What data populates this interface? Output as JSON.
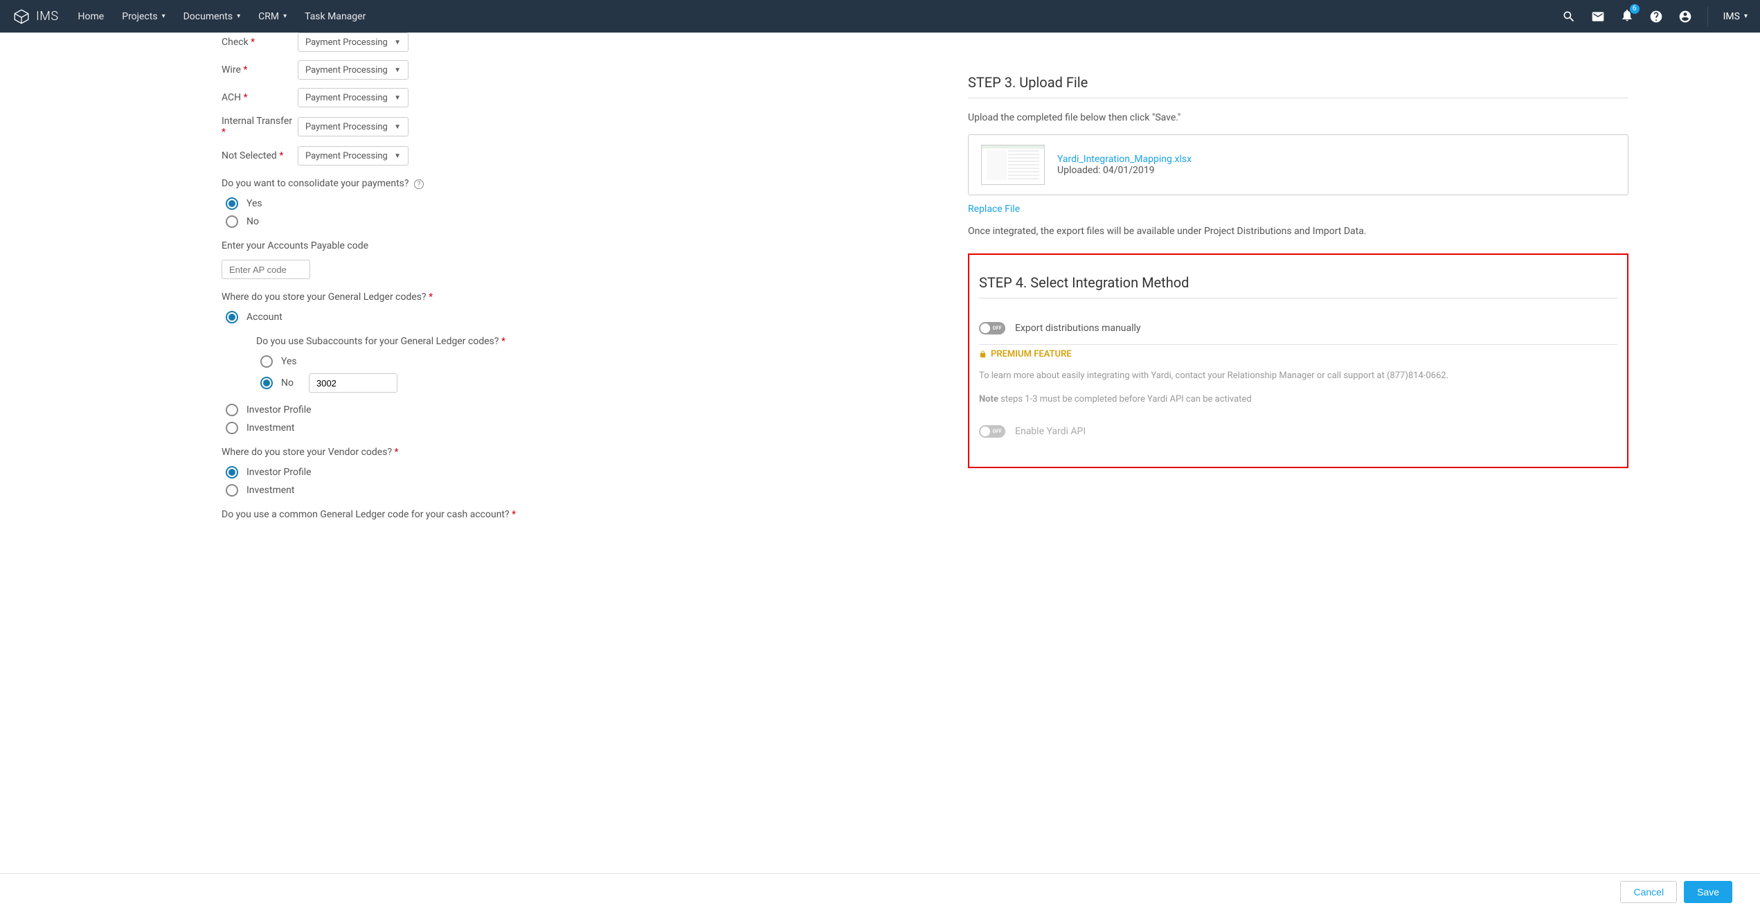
{
  "header": {
    "logo": "IMS",
    "nav": [
      "Home",
      "Projects",
      "Documents",
      "CRM",
      "Task Manager"
    ],
    "badge": "6",
    "org": "IMS"
  },
  "left": {
    "payment_rows": [
      {
        "label": "Check",
        "value": "Payment Processing"
      },
      {
        "label": "Wire",
        "value": "Payment Processing"
      },
      {
        "label": "ACH",
        "value": "Payment Processing"
      },
      {
        "label": "Internal Transfer",
        "value": "Payment Processing"
      },
      {
        "label": "Not Selected",
        "value": "Payment Processing"
      }
    ],
    "consolidate_q": "Do you want to consolidate your payments?",
    "yes": "Yes",
    "no": "No",
    "ap_label": "Enter your Accounts Payable code",
    "ap_placeholder": "Enter AP code",
    "gl_q": "Where do you store your General Ledger codes?",
    "opt_account": "Account",
    "sub_q": "Do you use Subaccounts for your General Ledger codes?",
    "sub_no_value": "3002",
    "opt_investor_profile": "Investor Profile",
    "opt_investment": "Investment",
    "vendor_q": "Where do you store your Vendor codes?",
    "common_gl_q": "Do you use a common General Ledger code for your cash account?"
  },
  "right": {
    "step3_title": "STEP 3. Upload File",
    "step3_desc": "Upload the completed file below then click \"Save.\"",
    "file_name": "Yardi_Integration_Mapping.xlsx",
    "file_uploaded": "Uploaded: 04/01/2019",
    "replace": "Replace File",
    "step3_after": "Once integrated, the export files will be available under Project Distributions and Import Data.",
    "step4_title": "STEP 4. Select Integration Method",
    "toggle_off": "OFF",
    "toggle1_label": "Export distributions manually",
    "premium_label": "PREMIUM FEATURE",
    "premium_text": "To learn more about easily integrating with Yardi, contact your Relationship Manager or call support at (877)814-0662.",
    "premium_note_bold": "Note",
    "premium_note": " steps 1-3 must be completed before Yardi API can be activated",
    "toggle2_label": "Enable Yardi API"
  },
  "footer": {
    "cancel": "Cancel",
    "save": "Save"
  }
}
